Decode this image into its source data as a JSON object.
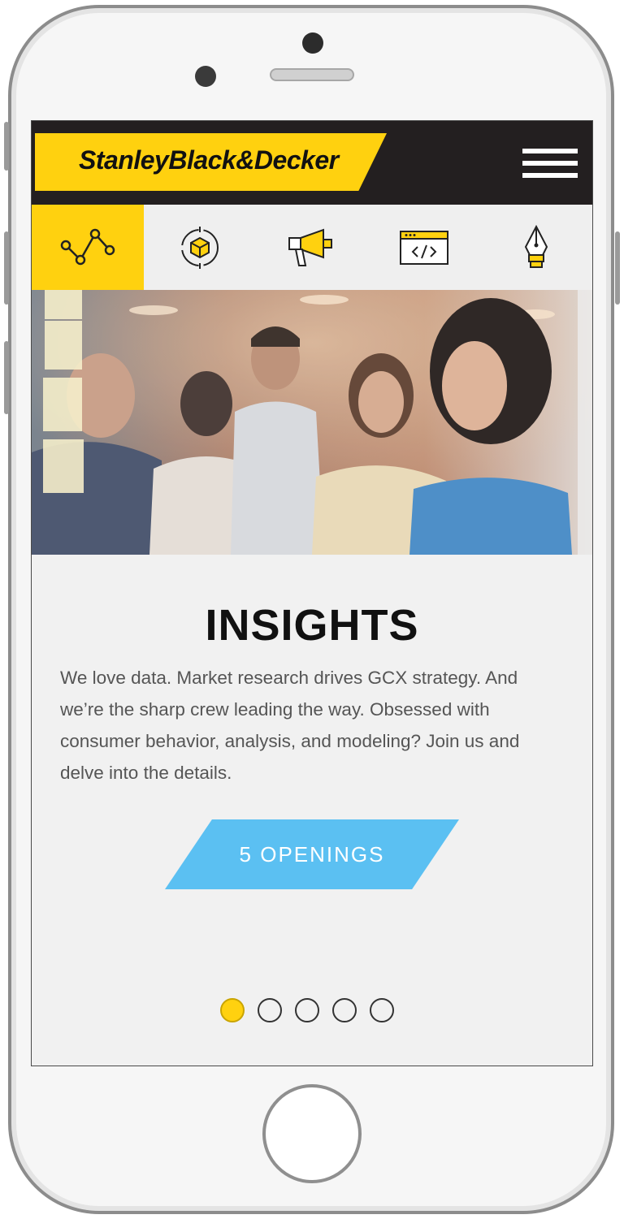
{
  "header": {
    "brand": "StanleyBlack&Decker"
  },
  "icon_tabs": [
    {
      "icon": "data-graph-icon",
      "active": true
    },
    {
      "icon": "3d-cube-target-icon",
      "active": false
    },
    {
      "icon": "megaphone-icon",
      "active": false
    },
    {
      "icon": "code-window-icon",
      "active": false
    },
    {
      "icon": "pen-nib-icon",
      "active": false
    }
  ],
  "section": {
    "title": "INSIGHTS",
    "description": "We love data. Market research drives GCX strategy. And we’re the sharp crew leading the way. Obsessed with consumer behavior, analysis, and modeling? Join us and delve into the details.",
    "cta_label": "5 OPENINGS"
  },
  "pagination": {
    "total": 5,
    "current": 1
  },
  "colors": {
    "brand_yellow": "#ffd10f",
    "header_dark": "#231f20",
    "cta_blue": "#5bc0f2"
  }
}
